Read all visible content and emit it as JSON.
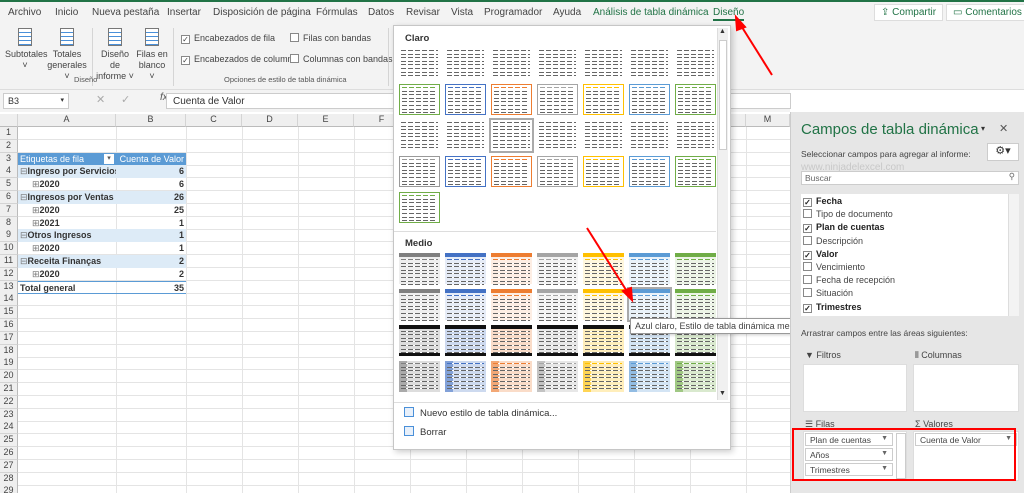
{
  "ribbon_tabs": [
    "Archivo",
    "Inicio",
    "Nueva pestaña",
    "Insertar",
    "Disposición de página",
    "Fórmulas",
    "Datos",
    "Revisar",
    "Vista",
    "Programador",
    "Ayuda",
    "Análisis de tabla dinámica",
    "Diseño"
  ],
  "active_tab": "Diseño",
  "share_label": "Compartir",
  "comments_label": "Comentarios",
  "ribbon": {
    "subtotales": "Subtotales",
    "totales1": "Totales",
    "totales2": "generales",
    "diseno1": "Diseño de",
    "diseno2": "informe",
    "filas1": "Filas en",
    "filas2": "blanco",
    "group_diseno": "Diseño",
    "opt_row_headers": "Encabezados de fila",
    "opt_col_headers": "Encabezados de columna",
    "opt_banded_rows": "Filas con bandas",
    "opt_banded_cols": "Columnas con bandas",
    "group_options": "Opciones de estilo de tabla dinámica"
  },
  "formula_bar": {
    "name_box": "B3",
    "fx": "fx",
    "value": "Cuenta de Valor"
  },
  "columns": [
    "A",
    "B",
    "C",
    "D",
    "E",
    "F",
    "M"
  ],
  "pivot": {
    "header": [
      "Etiquetas de fila",
      "Cuenta de Valor"
    ],
    "rows": [
      {
        "label": "Ingreso por Servicios",
        "value": "6",
        "level": 0
      },
      {
        "label": "2020",
        "value": "6",
        "level": 1
      },
      {
        "label": "Ingresos por Ventas",
        "value": "26",
        "level": 0
      },
      {
        "label": "2020",
        "value": "25",
        "level": 1
      },
      {
        "label": "2021",
        "value": "1",
        "level": 1
      },
      {
        "label": "Otros Ingresos",
        "value": "1",
        "level": 0
      },
      {
        "label": "2020",
        "value": "1",
        "level": 1
      },
      {
        "label": "Receita Finanças",
        "value": "2",
        "level": 0
      },
      {
        "label": "2020",
        "value": "2",
        "level": 1
      }
    ],
    "total": {
      "label": "Total general",
      "value": "35"
    }
  },
  "gallery": {
    "light_label": "Claro",
    "medium_label": "Medio",
    "palette": [
      "#808080",
      "#8c8c8c",
      "#4472c4",
      "#ed7d31",
      "#a5a5a5",
      "#ffc000",
      "#5b9bd5",
      "#70ad47"
    ],
    "new_style": "Nuevo estilo de tabla dinámica...",
    "clear": "Borrar",
    "tooltip": "Azul claro, Estilo de tabla dinámica medio 13"
  },
  "panel": {
    "title": "Campos de tabla dinámica",
    "subtitle": "Seleccionar campos para agregar al informe:",
    "watermark": "www.ninjadelexcel.com",
    "search_placeholder": "Buscar",
    "fields": [
      {
        "name": "Fecha",
        "checked": true
      },
      {
        "name": "Tipo de documento",
        "checked": false
      },
      {
        "name": "Plan de cuentas",
        "checked": true
      },
      {
        "name": "Descripción",
        "checked": false
      },
      {
        "name": "Valor",
        "checked": true
      },
      {
        "name": "Vencimiento",
        "checked": false
      },
      {
        "name": "Fecha de recepción",
        "checked": false
      },
      {
        "name": "Situación",
        "checked": false
      },
      {
        "name": "Trimestres",
        "checked": true
      }
    ],
    "drag_label": "Arrastrar campos entre las áreas siguientes:",
    "filters_label": "Filtros",
    "columns_label": "Columnas",
    "rows_label": "Filas",
    "values_label": "Valores",
    "row_fields": [
      "Plan de cuentas",
      "Años",
      "Trimestres"
    ],
    "value_fields": [
      "Cuenta de Valor"
    ]
  }
}
